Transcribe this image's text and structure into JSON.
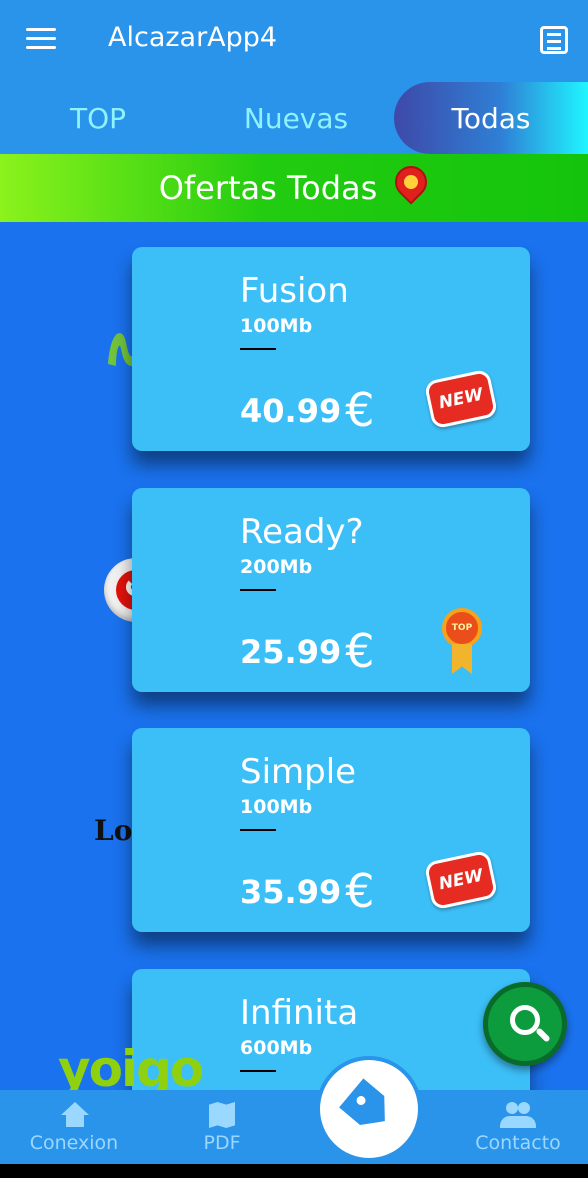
{
  "app": {
    "title": "AlcazarApp4"
  },
  "tabs": [
    {
      "label": "TOP"
    },
    {
      "label": "Nuevas"
    },
    {
      "label": "Todas",
      "selected": true
    }
  ],
  "banner": {
    "title": "Ofertas Todas"
  },
  "offers": [
    {
      "name": "Fusion",
      "speed": "100Mb",
      "price": "40.99",
      "currency": "€",
      "brand": "movistar",
      "badge": "NEW"
    },
    {
      "name": "Ready?",
      "speed": "200Mb",
      "price": "25.99",
      "currency": "€",
      "brand": "vodafone",
      "badge": "TOP"
    },
    {
      "name": "Simple",
      "speed": "100Mb",
      "price": "35.99",
      "currency": "€",
      "brand": "Lowi",
      "badge": "NEW"
    },
    {
      "name": "Infinita",
      "speed": "600Mb",
      "brand": "yoigo"
    }
  ],
  "bottom_nav": {
    "conexion": "Conexion",
    "pdf": "PDF",
    "contacto": "Contacto"
  },
  "colors": {
    "appbar": "#2a93ea",
    "background": "#1a72ee",
    "card": "#3cbff7",
    "banner_green": "#22cc10",
    "fab_green": "#0c9b3d"
  },
  "icons": {
    "menu": "menu-icon",
    "document": "document-icon",
    "location": "location-pin-icon",
    "search": "zoom-search-icon",
    "tag": "tag-icon",
    "home": "home-icon",
    "map": "map-icon",
    "people": "people-icon"
  }
}
